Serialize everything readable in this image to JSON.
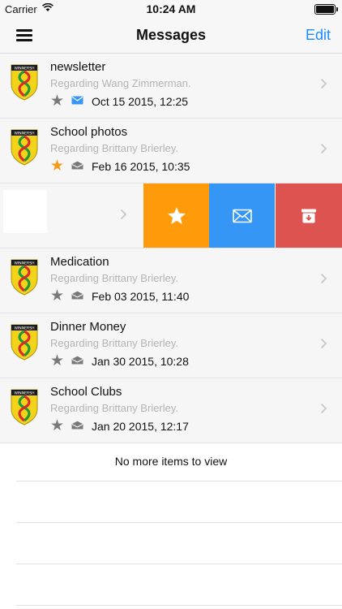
{
  "status_bar": {
    "carrier": "Carrier",
    "time": "10:24 AM"
  },
  "nav": {
    "title": "Messages",
    "edit_label": "Edit"
  },
  "colors": {
    "accent": "#1a8cff",
    "star_active": "#f59a18",
    "star_inactive": "#7a7a7a",
    "action_star": "#ff9b0a",
    "action_mail": "#3596f5",
    "action_archive": "#dc5350"
  },
  "messages": [
    {
      "subject": "newsletter",
      "regarding": "Regarding Wang Zimmerman.",
      "date": "Oct 15 2015, 12:25",
      "starred": false,
      "unread": true
    },
    {
      "subject": "School photos",
      "regarding": "Regarding Brittany Brierley.",
      "date": "Feb 16 2015, 10:35",
      "starred": true,
      "unread": false
    },
    {
      "subject": "Medication",
      "regarding": "Regarding Brittany Brierley.",
      "date": "Feb 03 2015, 11:40",
      "starred": false,
      "unread": false
    },
    {
      "subject": "Dinner Money",
      "regarding": "Regarding Brittany Brierley.",
      "date": "Jan 30 2015, 10:28",
      "starred": false,
      "unread": false
    },
    {
      "subject": "School Clubs",
      "regarding": "Regarding Brittany Brierley.",
      "date": "Jan 20 2015, 12:17",
      "starred": false,
      "unread": false
    }
  ],
  "swipe_actions": [
    "star-icon",
    "mail-icon",
    "archive-icon"
  ],
  "logo_label": "WINNERSH",
  "footer": {
    "no_more": "No more items to view"
  }
}
